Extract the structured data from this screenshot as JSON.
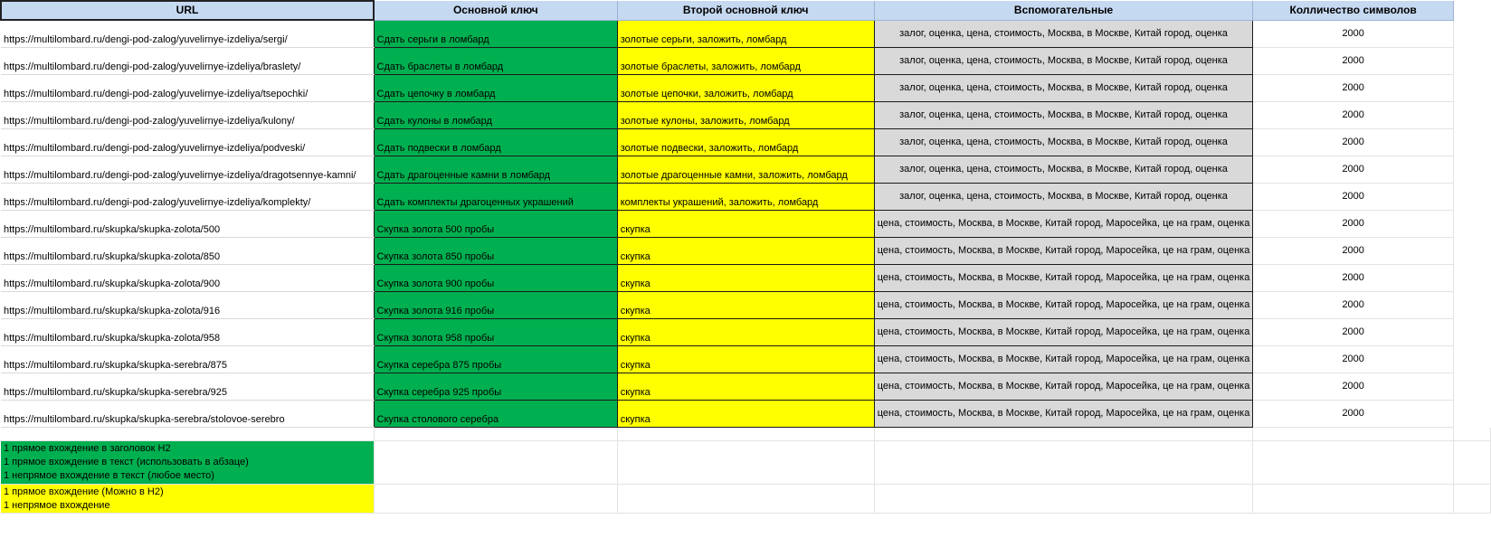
{
  "header": {
    "url": "URL",
    "key1": "Основной ключ",
    "key2": "Второй основной ключ",
    "aux": "Вспомогательные",
    "count": "Колличество символов"
  },
  "rows": [
    {
      "url": "https://multilombard.ru/dengi-pod-zalog/yuvelirnye-izdeliya/sergi/",
      "key1": "Сдать серьги в ломбард",
      "key2": "золотые серьги, заложить, ломбард",
      "aux": "залог, оценка, цена, стоимость, Москва, в Москве, Китай город, оценка",
      "count": "2000"
    },
    {
      "url": "https://multilombard.ru/dengi-pod-zalog/yuvelirnye-izdeliya/braslety/",
      "key1": "Сдать браслеты в ломбард",
      "key2": "золотые браслеты, заложить, ломбард",
      "aux": "залог, оценка, цена, стоимость, Москва, в Москве, Китай город, оценка",
      "count": "2000"
    },
    {
      "url": "https://multilombard.ru/dengi-pod-zalog/yuvelirnye-izdeliya/tsepochki/",
      "key1": "Сдать цепочку в ломбард",
      "key2": "золотые цепочки, заложить, ломбард",
      "aux": "залог, оценка, цена, стоимость, Москва, в Москве, Китай город, оценка",
      "count": "2000"
    },
    {
      "url": "https://multilombard.ru/dengi-pod-zalog/yuvelirnye-izdeliya/kulony/",
      "key1": "Сдать кулоны в ломбард",
      "key2": "золотые кулоны, заложить, ломбард",
      "aux": "залог, оценка, цена, стоимость, Москва, в Москве, Китай город, оценка",
      "count": "2000"
    },
    {
      "url": "https://multilombard.ru/dengi-pod-zalog/yuvelirnye-izdeliya/podveski/",
      "key1": "Сдать подвески в ломбард",
      "key2": "золотые подвески, заложить, ломбард",
      "aux": "залог, оценка, цена, стоимость, Москва, в Москве, Китай город, оценка",
      "count": "2000"
    },
    {
      "url": "https://multilombard.ru/dengi-pod-zalog/yuvelirnye-izdeliya/dragotsennye-kamni/",
      "key1": "Сдать драгоценные камни в ломбард",
      "key2": "золотые драгоценные камни, заложить, ломбард",
      "aux": "залог, оценка, цена, стоимость, Москва, в Москве, Китай город, оценка",
      "count": "2000"
    },
    {
      "url": "https://multilombard.ru/dengi-pod-zalog/yuvelirnye-izdeliya/komplekty/",
      "key1": "Сдать комплекты драгоценных украшений",
      "key2": "комплекты украшений, заложить, ломбард",
      "aux": "залог, оценка, цена, стоимость, Москва, в Москве, Китай город, оценка",
      "count": "2000"
    },
    {
      "url": "https://multilombard.ru/skupka/skupka-zolota/500",
      "key1": "Скупка золота 500 пробы",
      "key2": "скупка",
      "aux": "цена, стоимость, Москва, в Москве, Китай город, Маросейка, це на грам, оценка",
      "count": "2000"
    },
    {
      "url": "https://multilombard.ru/skupka/skupka-zolota/850",
      "key1": "Скупка золота 850 пробы",
      "key2": "скупка",
      "aux": "цена, стоимость, Москва, в Москве, Китай город, Маросейка, це на грам, оценка",
      "count": "2000"
    },
    {
      "url": "https://multilombard.ru/skupka/skupka-zolota/900",
      "key1": "Скупка золота 900 пробы",
      "key2": "скупка",
      "aux": "цена, стоимость, Москва, в Москве, Китай город, Маросейка, це на грам, оценка",
      "count": "2000"
    },
    {
      "url": "https://multilombard.ru/skupka/skupka-zolota/916",
      "key1": "Скупка золота 916 пробы",
      "key2": "скупка",
      "aux": "цена, стоимость, Москва, в Москве, Китай город, Маросейка, це на грам, оценка",
      "count": "2000"
    },
    {
      "url": "https://multilombard.ru/skupka/skupka-zolota/958",
      "key1": "Скупка золота 958 пробы",
      "key2": "скупка",
      "aux": "цена, стоимость, Москва, в Москве, Китай город, Маросейка, це на грам, оценка",
      "count": "2000"
    },
    {
      "url": "https://multilombard.ru/skupka/skupka-serebra/875",
      "key1": "Скупка серебра 875 пробы",
      "key2": "скупка",
      "aux": "цена, стоимость, Москва, в Москве, Китай город, Маросейка, це на грам, оценка",
      "count": "2000"
    },
    {
      "url": "https://multilombard.ru/skupka/skupka-serebra/925",
      "key1": "Скупка серебра 925 пробы",
      "key2": "скупка",
      "aux": "цена, стоимость, Москва, в Москве, Китай город, Маросейка, це на грам, оценка",
      "count": "2000"
    },
    {
      "url": "https://multilombard.ru/skupka/skupka-serebra/stolovoe-serebro",
      "key1": "Скупка столового серебра",
      "key2": "скупка",
      "aux": "цена, стоимость, Москва, в Москве, Китай город, Маросейка, це на грам, оценка",
      "count": "2000"
    }
  ],
  "legend": {
    "green": [
      "1 прямое вхождение в заголовок H2",
      "1 прямое вхождение в текст (использовать в абзаце)",
      "1 непрямое вхождение в текст (любое место)"
    ],
    "yellow": [
      "1 прямое вхождение (Можно в H2)",
      "1 непрямое вхождение"
    ]
  },
  "colors": {
    "header": "#c5d9f1",
    "key1": "#00b050",
    "key2": "#ffff00",
    "aux": "#d9d9d9"
  }
}
